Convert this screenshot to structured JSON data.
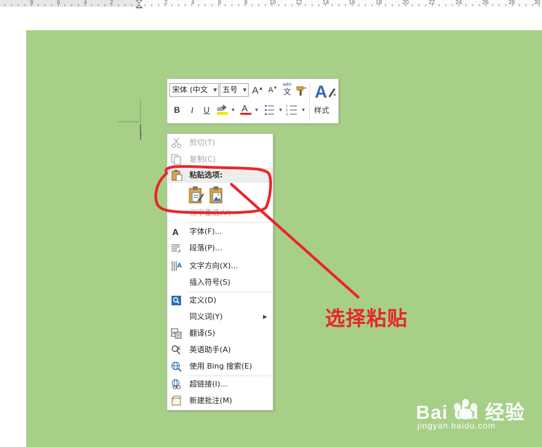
{
  "ruler": {
    "numbers": [
      "8",
      "6",
      "4",
      "2",
      "2",
      "4",
      "6",
      "8",
      "10",
      "12",
      "14",
      "16",
      "18",
      "20",
      "22",
      "24",
      "26",
      "28",
      "30"
    ]
  },
  "mini_toolbar": {
    "font_name": "宋体 (中文",
    "font_size": "五号",
    "grow_font": "A",
    "shrink_font": "A",
    "phonetic": "wén",
    "phonetic_char": "文",
    "bold": "B",
    "italic": "I",
    "underline": "U",
    "font_color": "A",
    "styles_label": "样式",
    "highlight_color": "#f5e600",
    "font_color_value": "#e8262a"
  },
  "context_menu": {
    "cut": "剪切(T)",
    "copy": "复制(C)",
    "paste_options": "粘贴选项:",
    "hidden_item": "汉字重选(V)",
    "font": "字体(F)...",
    "paragraph": "段落(P)...",
    "text_direction": "文字方向(X)...",
    "insert_symbol": "插入符号(S)",
    "define": "定义(D)",
    "synonyms": "同义词(Y)",
    "translate": "翻译(S)",
    "english_assistant": "英语助手(A)",
    "bing_search": "使用 Bing 搜索(E)",
    "hyperlink": "超链接(I)...",
    "new_comment": "新建批注(M)"
  },
  "annotation": {
    "callout_text": "选择粘贴",
    "color": "#e8262a"
  },
  "watermark": {
    "brand": "Bai du 经验",
    "url": "jingyan.baidu.com"
  },
  "colors": {
    "page_background": "#a7cf88",
    "menu_background": "#ffffff",
    "annotation": "#e8262a"
  }
}
